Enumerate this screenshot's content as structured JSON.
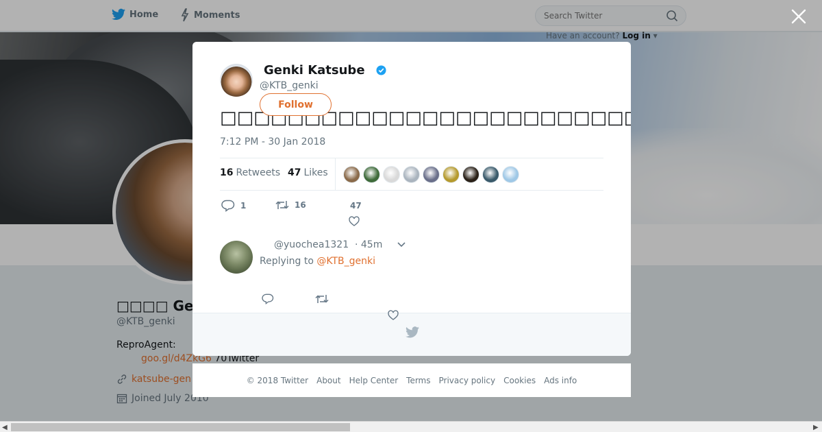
{
  "topbar": {
    "home_label": "Home",
    "moments_label": "Moments",
    "search_placeholder": "Search Twitter",
    "have_account": "Have an account?",
    "login_label": "Log in"
  },
  "profile": {
    "name": "□□□□ Genk",
    "handle": "@KTB_genki",
    "bio_prefix": "ReproAgent:",
    "bio_link": "goo.gl/d4ZkG6",
    "bio_suffix": "70Twitter",
    "url": "katsube-gen",
    "joined": "Joined July 2010"
  },
  "tweet": {
    "author_name": "Genki Katsube",
    "author_handle": "@KTB_genki",
    "follow_label": "Follow",
    "text": "□□□□□□□□□□□□□□□□□□□□□□□□□□□□□□□□□□□□□□□□□□□□□□□□□□□",
    "time": "7:12 PM - 30 Jan 2018",
    "retweets_count": "16",
    "retweets_label": "Retweets",
    "likes_count": "47",
    "likes_label": "Likes",
    "reply_count": "1",
    "retweet_action_count": "16",
    "like_action_count": "47",
    "likers_colors": [
      "#8a6a4a",
      "#3f6b3a",
      "#d9d9d9",
      "#aab4be",
      "#6a6f8a",
      "#b59a2e",
      "#2a2118",
      "#3a5a6a",
      "#9fc8e6"
    ]
  },
  "reply": {
    "handle": "@yuochea1321",
    "time": "· 45m",
    "replying_prefix": "Replying to",
    "replying_handle": "@KTB_genki"
  },
  "footer": {
    "copyright": "© 2018 Twitter",
    "about": "About",
    "help": "Help Center",
    "terms": "Terms",
    "privacy": "Privacy policy",
    "cookies": "Cookies",
    "ads": "Ads info"
  },
  "colors": {
    "accent": "#e0702f",
    "verified": "#1da1f2",
    "twitter_blue": "#1da1f2"
  }
}
